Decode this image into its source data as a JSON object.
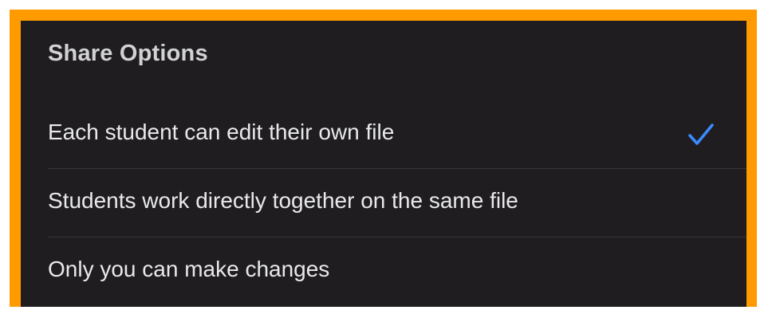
{
  "share_options": {
    "title": "Share Options",
    "items": [
      {
        "label": "Each student can edit their own file",
        "selected": true
      },
      {
        "label": "Students work directly together on the same file",
        "selected": false
      },
      {
        "label": "Only you can make changes",
        "selected": false
      }
    ],
    "check_icon": "checkmark-icon"
  },
  "colors": {
    "frame_accent": "#ff9b00",
    "panel_background": "#1f1d20",
    "checkmark": "#3a8bff"
  }
}
